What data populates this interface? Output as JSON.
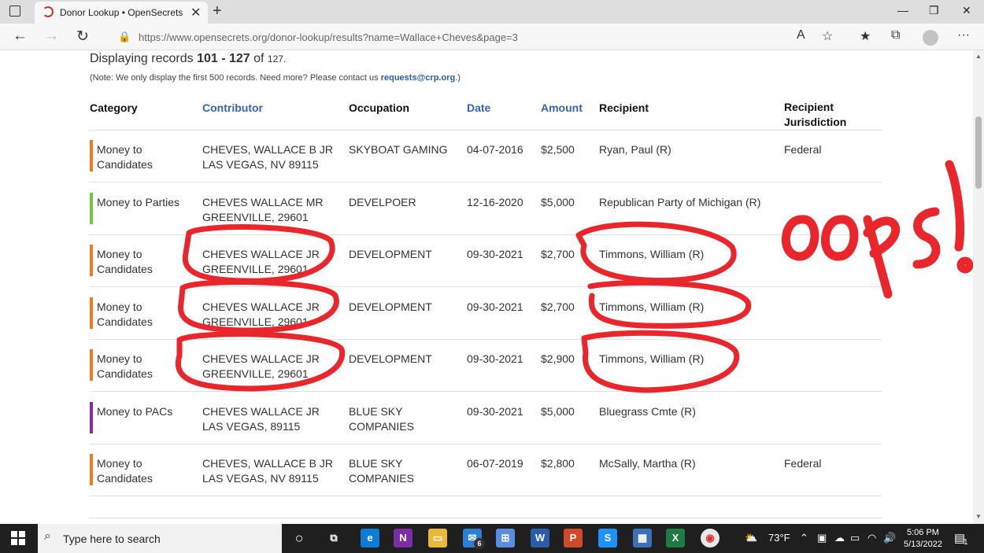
{
  "browser": {
    "tab_title": "Donor Lookup • OpenSecrets",
    "url": "https://www.opensecrets.org/donor-lookup/results?name=Wallace+Cheves&page=3"
  },
  "page": {
    "records_prefix": "Displaying records",
    "records_range": "101 - 127",
    "records_of": "of",
    "records_total": "127.",
    "note_prefix": "(Note: We only display the first 500 records. Need more? Please contact us",
    "note_email": "requests@crp.org",
    "note_suffix": ".)",
    "columns": [
      "Category",
      "Contributor",
      "Occupation",
      "Date",
      "Amount",
      "Recipient",
      "Recipient Jurisdiction"
    ],
    "rows": [
      {
        "category": "Money to Candidates",
        "category_color": "#f07a22",
        "contributor_1": "CHEVES, WALLACE B JR",
        "contributor_2": "LAS VEGAS, NV 89115",
        "occupation": "SKYBOAT GAMING",
        "date": "04-07-2016",
        "amount": "$2,500",
        "recipient": "Ryan, Paul (R)",
        "jurisdiction": "Federal"
      },
      {
        "category": "Money to Parties",
        "category_color": "#7cc142",
        "contributor_1": "CHEVES WALLACE MR",
        "contributor_2": "GREENVILLE, 29601",
        "occupation": "DEVELPOER",
        "date": "12-16-2020",
        "amount": "$5,000",
        "recipient": "Republican Party of Michigan (R)",
        "jurisdiction": ""
      },
      {
        "category": "Money to Candidates",
        "category_color": "#f07a22",
        "contributor_1": "CHEVES WALLACE JR",
        "contributor_2": "GREENVILLE, 29601",
        "occupation": "DEVELOPMENT",
        "date": "09-30-2021",
        "amount": "$2,700",
        "recipient": "Timmons, William (R)",
        "jurisdiction": ""
      },
      {
        "category": "Money to Candidates",
        "category_color": "#f07a22",
        "contributor_1": "CHEVES WALLACE JR",
        "contributor_2": "GREENVILLE, 29601",
        "occupation": "DEVELOPMENT",
        "date": "09-30-2021",
        "amount": "$2,700",
        "recipient": "Timmons, William (R)",
        "jurisdiction": ""
      },
      {
        "category": "Money to Candidates",
        "category_color": "#f07a22",
        "contributor_1": "CHEVES WALLACE JR",
        "contributor_2": "GREENVILLE, 29601",
        "occupation": "DEVELOPMENT",
        "date": "09-30-2021",
        "amount": "$2,900",
        "recipient": "Timmons, William (R)",
        "jurisdiction": ""
      },
      {
        "category": "Money to PACs",
        "category_color": "#8e2a9a",
        "contributor_1": "CHEVES WALLACE JR",
        "contributor_2": "LAS VEGAS, 89115",
        "occupation": "BLUE SKY COMPANIES",
        "date": "09-30-2021",
        "amount": "$5,000",
        "recipient": "Bluegrass Cmte (R)",
        "jurisdiction": ""
      },
      {
        "category": "Money to Candidates",
        "category_color": "#f07a22",
        "contributor_1": "CHEVES, WALLACE B JR",
        "contributor_2": "LAS VEGAS, NV 89115",
        "occupation": "BLUE SKY COMPANIES",
        "date": "06-07-2019",
        "amount": "$2,800",
        "recipient": "McSally, Martha (R)",
        "jurisdiction": "Federal"
      }
    ]
  },
  "annotation": {
    "text": "oops!",
    "color": "#e8262b"
  },
  "taskbar": {
    "search_placeholder": "Type here to search",
    "temperature": "73°F",
    "time": "5:06 PM",
    "date": "5/13/2022",
    "mail_badge": "6",
    "notification_badge": "1"
  }
}
